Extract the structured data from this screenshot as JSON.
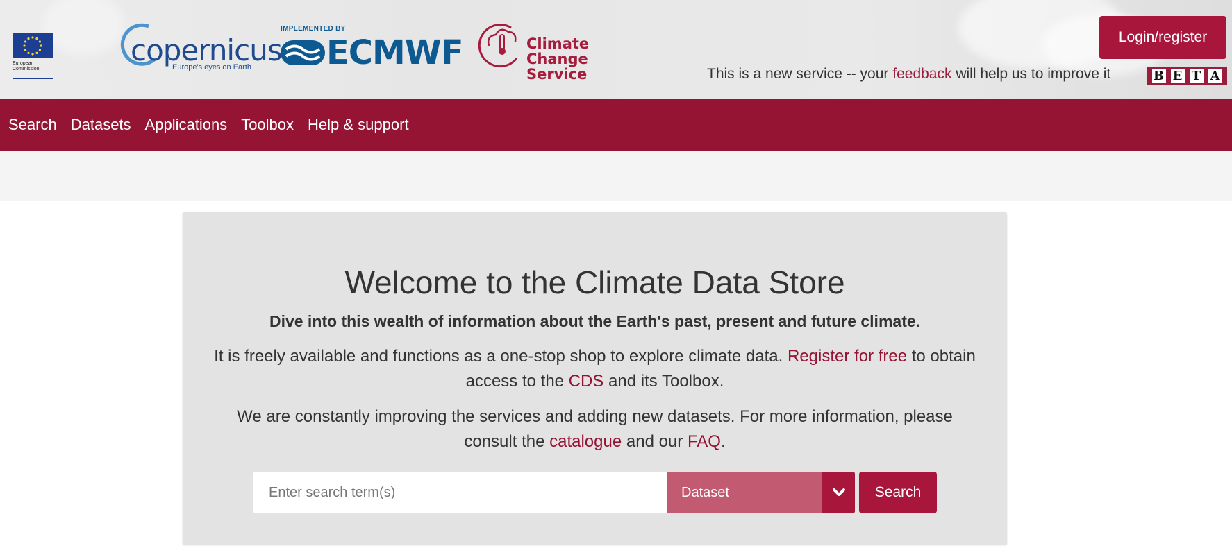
{
  "header": {
    "eu_logo_text": "European Commission",
    "copernicus_logo": {
      "name": "copernicus",
      "tagline": "Europe's eyes on Earth"
    },
    "ecmwf_logo": {
      "implemented_by": "IMPLEMENTED BY",
      "name": "ECMWF"
    },
    "c3s_logo": {
      "line1": "Climate Change",
      "line2": "Service"
    },
    "login_label": "Login/register",
    "notice_prefix": "This is a new service -- your ",
    "notice_link": "feedback",
    "notice_suffix": " will help us to improve it",
    "beta_letters": [
      "B",
      "E",
      "T",
      "A"
    ]
  },
  "nav": {
    "items": [
      "Search",
      "Datasets",
      "Applications",
      "Toolbox",
      "Help & support"
    ]
  },
  "welcome": {
    "title": "Welcome to the Climate Data Store",
    "lead": "Dive into this wealth of information about the Earth's past, present and future climate.",
    "p1_a": "It is freely available and functions  as a one-stop shop to explore climate data. ",
    "p1_link1": "Register for free",
    "p1_b": " to obtain access to the ",
    "p1_link2": "CDS",
    "p1_c": " and its Toolbox.",
    "p2_a": "We are constantly improving the services and adding new datasets. For more information, please consult the ",
    "p2_link1": "catalogue",
    "p2_b": " and our ",
    "p2_link2": "FAQ",
    "p2_c": "."
  },
  "search": {
    "placeholder": "Enter search term(s)",
    "dataset_value": "Dataset",
    "button_label": "Search"
  },
  "colors": {
    "brand": "#951333",
    "button": "#a8163c",
    "select": "#c25b72"
  }
}
